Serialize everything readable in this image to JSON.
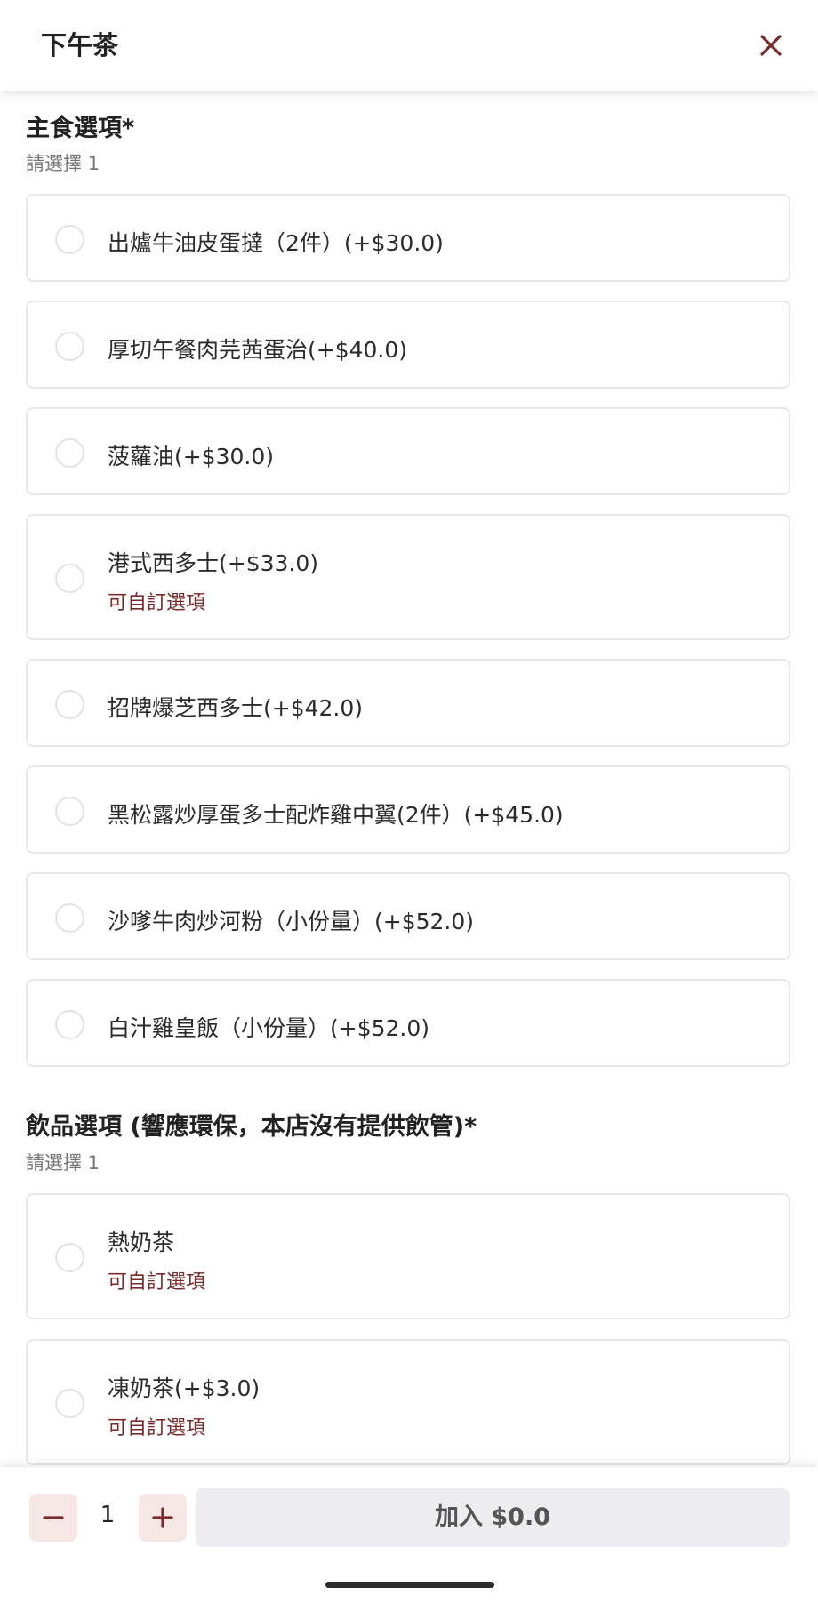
{
  "header": {
    "title": "下午茶"
  },
  "sections": [
    {
      "title": "主食選項*",
      "subtitle": "請選擇 1",
      "options": [
        {
          "label": "出爐牛油皮蛋撻（2件）(+$30.0)"
        },
        {
          "label": "厚切午餐肉芫茜蛋治(+$40.0)"
        },
        {
          "label": "菠蘿油(+$30.0)"
        },
        {
          "label": "港式西多士(+$33.0)",
          "custom": "可自訂選項"
        },
        {
          "label": "招牌爆芝西多士(+$42.0)"
        },
        {
          "label": "黑松露炒厚蛋多士配炸雞中翼(2件）(+$45.0)"
        },
        {
          "label": "沙嗲牛肉炒河粉（小份量）(+$52.0)"
        },
        {
          "label": "白汁雞皇飯（小份量）(+$52.0)"
        }
      ]
    },
    {
      "title": "飲品選項 (響應環保，本店沒有提供飲管)*",
      "subtitle": "請選擇 1",
      "options": [
        {
          "label": "熱奶茶",
          "custom": "可自訂選項"
        },
        {
          "label": "凍奶茶(+$3.0)",
          "custom": "可自訂選項"
        }
      ]
    }
  ],
  "footer": {
    "quantity": "1",
    "add_label": "加入 $0.0"
  },
  "colors": {
    "accent": "#7a2a2a",
    "qty_button_bg": "#f6e6e6",
    "add_button_bg": "#ececf1",
    "card_border": "#e8e8ea"
  }
}
